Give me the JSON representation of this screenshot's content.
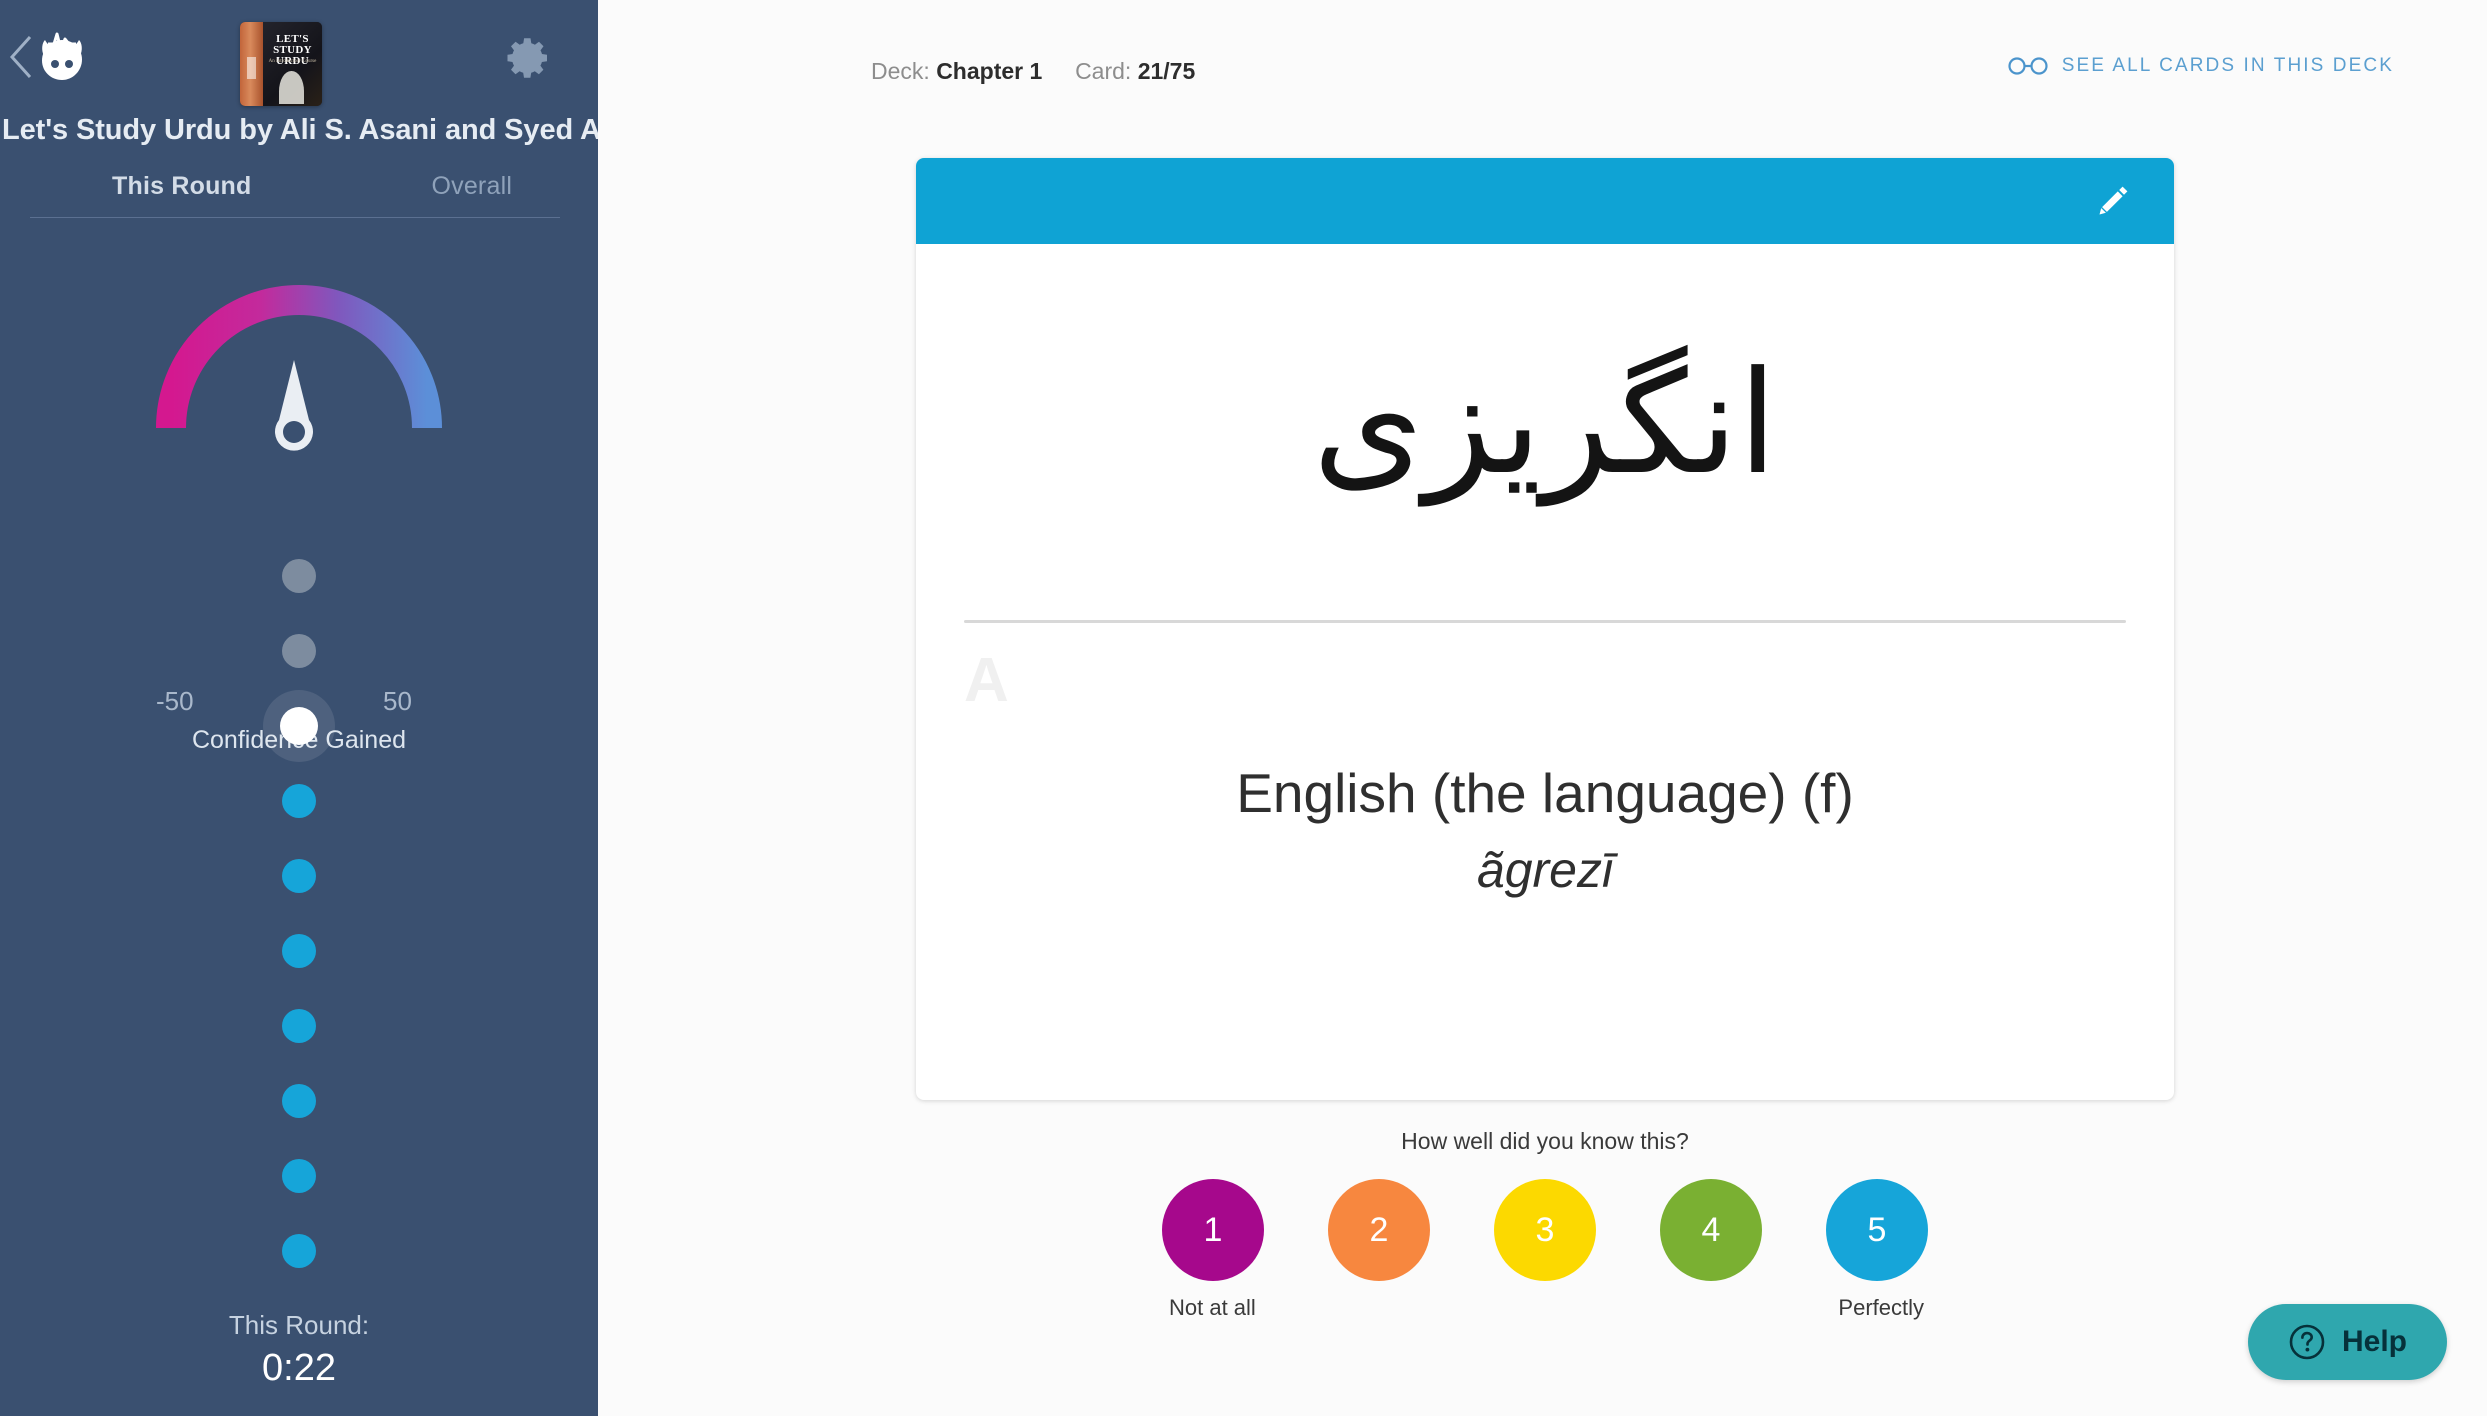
{
  "sidebar": {
    "back_label": "Back",
    "logo_name": "Brainscape mascot",
    "book_cover": {
      "title_line1": "LET'S",
      "title_line2": "STUDY",
      "title_line3": "URDU",
      "subtitle": "An Introductory Course"
    },
    "settings_label": "Settings",
    "deck_title": "Let's Study Urdu by Ali S. Asani and Syed Akbar",
    "tabs": [
      {
        "label": "This Round",
        "active": true
      },
      {
        "label": "Overall",
        "active": false
      }
    ],
    "gauge": {
      "min_label": "-50",
      "max_label": "50",
      "caption": "Confidence Gained",
      "value": 0,
      "color_left": "#d4188f",
      "color_right": "#5c8fd8"
    },
    "progress_dots": [
      {
        "state": "gray"
      },
      {
        "state": "gray"
      },
      {
        "state": "current"
      },
      {
        "state": "blue"
      },
      {
        "state": "blue"
      },
      {
        "state": "blue"
      },
      {
        "state": "blue"
      },
      {
        "state": "blue"
      },
      {
        "state": "blue"
      },
      {
        "state": "blue"
      }
    ],
    "timer": {
      "label": "This Round:",
      "value": "0:22"
    },
    "bg_color": "#3a5070"
  },
  "header": {
    "deck_prefix": "Deck:",
    "deck_name": "Chapter 1",
    "card_prefix": "Card:",
    "card_position": "21/75",
    "see_all_label": "See all cards in this deck",
    "see_all_color": "#5b9fd4"
  },
  "card": {
    "topbar_color": "#0fa3d4",
    "edit_label": "Edit card",
    "question_text": "انگریزی",
    "answer_mark": "A",
    "answer_main": "English (the language) (f)",
    "answer_sub": "ãgrezī"
  },
  "rating": {
    "prompt": "How well did you know this?",
    "buttons": [
      {
        "value": "1",
        "color": "#a6088c"
      },
      {
        "value": "2",
        "color": "#f7873f"
      },
      {
        "value": "3",
        "color": "#fcd900"
      },
      {
        "value": "4",
        "color": "#7ab032"
      },
      {
        "value": "5",
        "color": "#16a5d9"
      }
    ],
    "low_label": "Not at all",
    "high_label": "Perfectly"
  },
  "help": {
    "label": "Help",
    "color": "#2fa7ae"
  }
}
